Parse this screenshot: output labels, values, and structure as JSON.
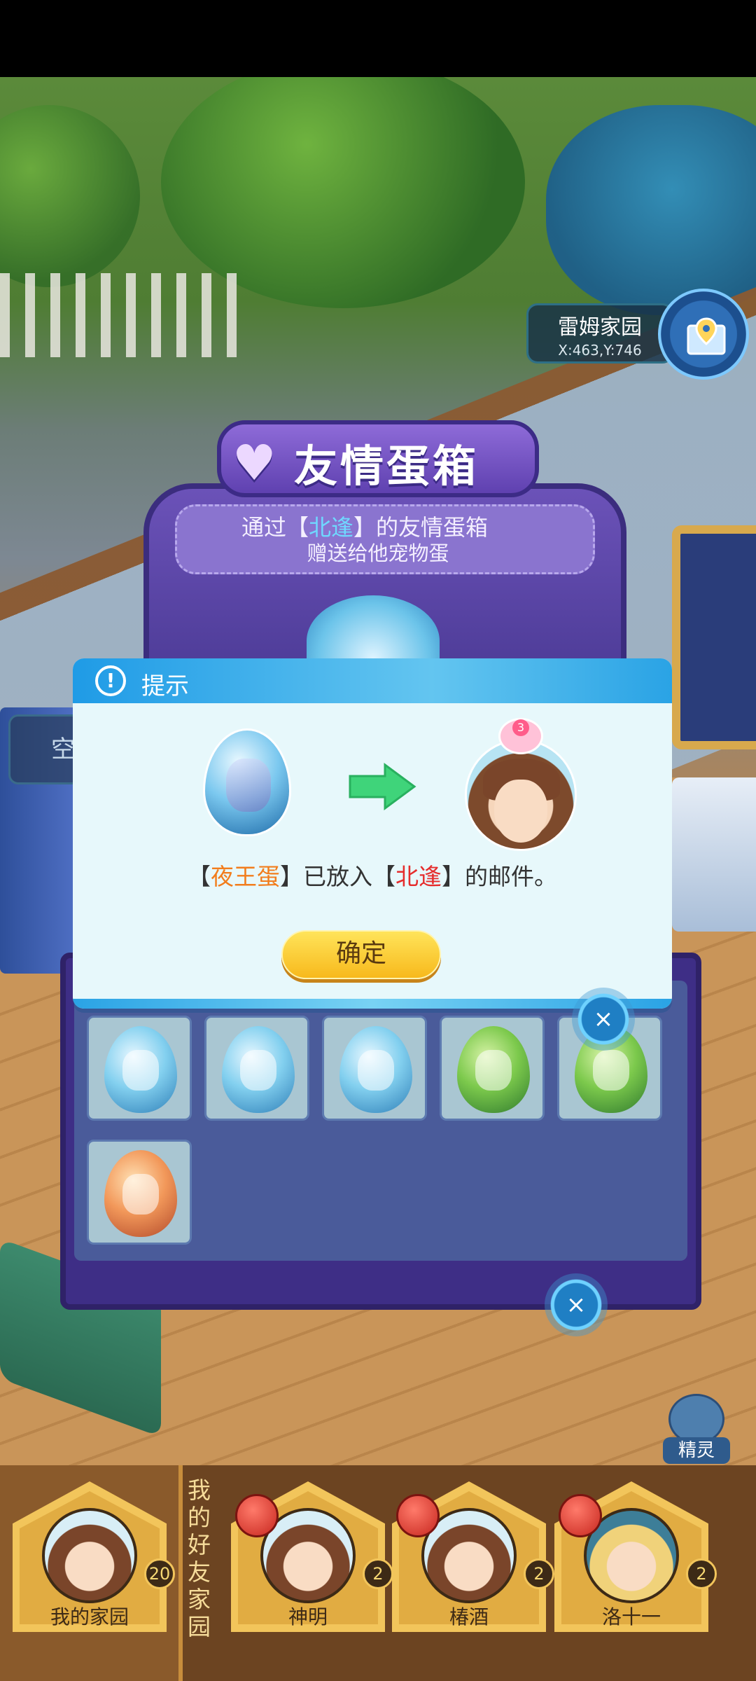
{
  "scene": {
    "location": {
      "name": "雷姆家园",
      "coords": "X:463,Y:746"
    },
    "side_empty_text": "空",
    "spirit_label": "精灵"
  },
  "egg_box": {
    "title": "友情蛋箱",
    "line1_prefix": "通过【",
    "line1_name": "北逢",
    "line1_suffix": "】的友情蛋箱",
    "line2": "赠送给他宠物蛋",
    "eggs": [
      "blue",
      "blue",
      "blue",
      "green",
      "green",
      "orange"
    ]
  },
  "dialog": {
    "title": "提示",
    "warn_icon": "!",
    "msg_open1": "【",
    "msg_item": "夜王蛋",
    "msg_mid": "】已放入【",
    "msg_name": "北逢",
    "msg_end": "】的邮件。",
    "pet_badge": "3",
    "confirm": "确定",
    "close_symbol": "×"
  },
  "friends": {
    "title": "我的好友家园",
    "my_home": {
      "label": "我的家园",
      "count": "20"
    },
    "items": [
      {
        "label": "神明",
        "count": "2"
      },
      {
        "label": "椿酒",
        "count": "2"
      },
      {
        "label": "洛十一",
        "count": "2"
      }
    ]
  },
  "colors": {
    "dialog_header": "#1f9be6",
    "confirm_button": "#f7b91c",
    "highlight_orange": "#f27d1c",
    "highlight_red": "#e52c2c",
    "highlight_cyan": "#6fd8ff"
  }
}
